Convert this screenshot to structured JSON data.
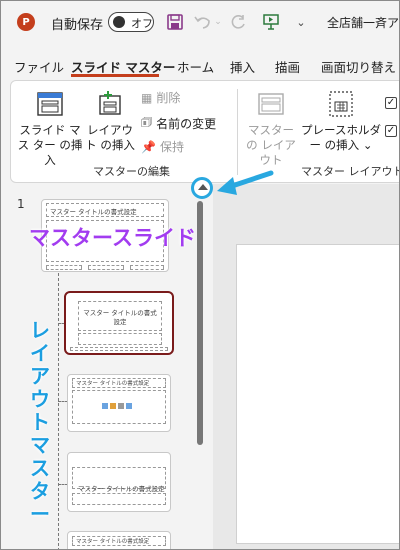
{
  "titlebar": {
    "app_logo": "P",
    "autosave_label": "自動保存",
    "toggle_state": "オフ",
    "doc_title": "全店舗一斉アン"
  },
  "tabs": [
    {
      "label": "ファイル"
    },
    {
      "label": "スライド マスター",
      "active": true
    },
    {
      "label": "ホーム"
    },
    {
      "label": "挿入"
    },
    {
      "label": "描画"
    },
    {
      "label": "画面切り替え"
    }
  ],
  "ribbon": {
    "insert_master": "スライド マス ター の挿入",
    "insert_layout": "レイアウト の挿入",
    "delete": "削除",
    "rename": "名前の変更",
    "preserve": "保持",
    "group_edit": "マスターの編集",
    "master_layout": "マスターの レイアウト",
    "insert_placeholder": "プレースホルダー の挿入 ⌄",
    "group_layout": "マスター レイアウト"
  },
  "panel": {
    "slide_number": "1",
    "thumb_title": "マスター タイトルの書式設定",
    "thumb_title_short": "マスター タイトルの書式設定",
    "selected_title": "マスター タイトルの書式 設定"
  },
  "annotations": {
    "master_label": "マスタースライド",
    "layout_label": "レイアウトマスター",
    "accent_purple": "#a23cf0",
    "accent_blue": "#1b9ee0"
  },
  "colors": {
    "ppt_red": "#c43e1c",
    "selected_border": "#7a1b1b"
  }
}
